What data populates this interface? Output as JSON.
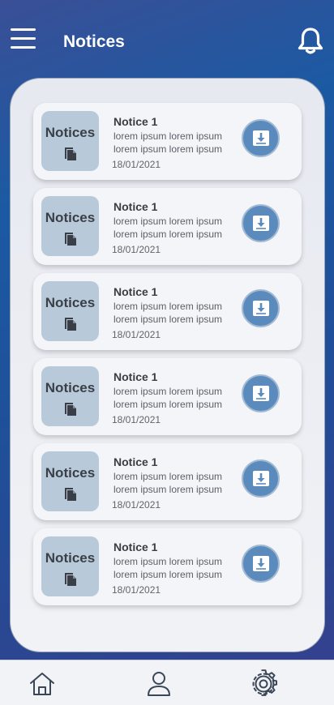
{
  "header": {
    "title": "Notices"
  },
  "notices": [
    {
      "thumb_label": "Notices",
      "title": "Notice 1",
      "body": "lorem ipsum lorem ipsum lorem ipsum lorem ipsum",
      "date": "18/01/2021"
    },
    {
      "thumb_label": "Notices",
      "title": "Notice 1",
      "body": "lorem ipsum lorem ipsum lorem ipsum lorem ipsum",
      "date": "18/01/2021"
    },
    {
      "thumb_label": "Notices",
      "title": "Notice 1",
      "body": "lorem ipsum lorem ipsum lorem ipsum lorem ipsum",
      "date": "18/01/2021"
    },
    {
      "thumb_label": "Notices",
      "title": "Notice 1",
      "body": "lorem ipsum lorem ipsum lorem ipsum lorem ipsum",
      "date": "18/01/2021"
    },
    {
      "thumb_label": "Notices",
      "title": "Notice 1",
      "body": "lorem ipsum lorem ipsum lorem ipsum lorem ipsum",
      "date": "18/01/2021"
    },
    {
      "thumb_label": "Notices",
      "title": "Notice 1",
      "body": "lorem ipsum lorem ipsum lorem ipsum lorem ipsum",
      "date": "18/01/2021"
    }
  ],
  "icons": {
    "menu": "hamburger-menu-icon",
    "notifications": "bell-icon",
    "document": "document-copy-icon",
    "download": "download-icon",
    "home": "home-icon",
    "profile": "user-icon",
    "settings": "gear-icon"
  },
  "colors": {
    "background_top": "#3a4f96",
    "background_mid": "#1b5aa3",
    "panel": "#eceef3",
    "card": "#f4f5f8",
    "thumb": "#b8c9d9",
    "download_button": "#5b8bbd",
    "bottom_nav": "#f1f3f7"
  }
}
